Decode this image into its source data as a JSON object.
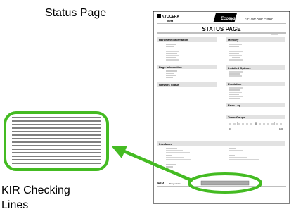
{
  "captions": {
    "status_page": "Status Page",
    "kir_line1": "KIR Checking",
    "kir_line2": "Lines"
  },
  "document": {
    "brand": "KYOCERA",
    "brand_sub": "mita",
    "ecosys_logo": "Ecosys",
    "model": "FS-1900 Page Printer",
    "title": "STATUS PAGE",
    "left_sections": [
      "Hardware Information",
      "Page Information",
      "Network Status"
    ],
    "right_sections": [
      "Memory",
      "Installed Options",
      "Emulation",
      "Error Log",
      "Toner Gauge"
    ],
    "interfaces_label": "Interfaces",
    "kir_label": "KIR",
    "kir_test": "Test pattern",
    "toner_min": "0",
    "toner_max": "100"
  },
  "colors": {
    "highlight_green": "#44bb22",
    "section_bar": "#e2e2e2",
    "kir_bar": "#aaaaaa"
  }
}
